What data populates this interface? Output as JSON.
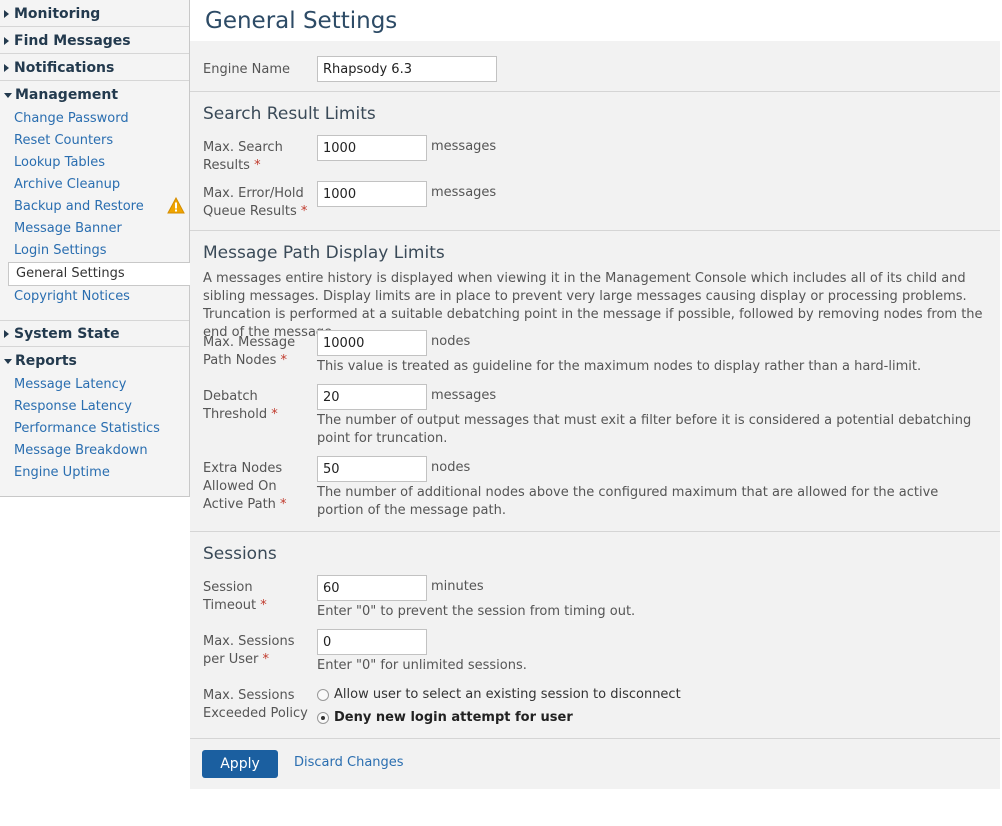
{
  "sidebar": {
    "monitoring": "Monitoring",
    "find_messages": "Find Messages",
    "notifications": "Notifications",
    "management": "Management",
    "management_items": [
      "Change Password",
      "Reset Counters",
      "Lookup Tables",
      "Archive Cleanup",
      "Backup and Restore",
      "Message Banner",
      "Login Settings",
      "General Settings",
      "Copyright Notices"
    ],
    "active_item": "General Settings",
    "warning_item": "Backup and Restore",
    "system_state": "System State",
    "reports": "Reports",
    "reports_items": [
      "Message Latency",
      "Response Latency",
      "Performance Statistics",
      "Message Breakdown",
      "Engine Uptime"
    ]
  },
  "page": {
    "title": "General Settings"
  },
  "engine": {
    "label": "Engine Name",
    "value": "Rhapsody 6.3"
  },
  "search_limits": {
    "title": "Search Result Limits",
    "max_search_label_1": "Max. Search",
    "max_search_label_2": "Results",
    "max_search_value": "1000",
    "max_search_unit": "messages",
    "max_error_label_1": "Max. Error/Hold",
    "max_error_label_2": "Queue Results",
    "max_error_value": "1000",
    "max_error_unit": "messages"
  },
  "path_limits": {
    "title": "Message Path Display Limits",
    "description": "A messages entire history is displayed when viewing it in the Management Console which includes all of its child and sibling messages. Display limits are in place to prevent very large messages causing display or processing problems. Truncation is performed at a suitable debatching point in the message if possible, followed by removing nodes from the end of the message.",
    "max_nodes_label_1": "Max. Message",
    "max_nodes_label_2": "Path Nodes",
    "max_nodes_value": "10000",
    "max_nodes_unit": "nodes",
    "max_nodes_help": "This value is treated as guideline for the maximum nodes to display rather than a hard-limit.",
    "debatch_label_1": "Debatch",
    "debatch_label_2": "Threshold",
    "debatch_value": "20",
    "debatch_unit": "messages",
    "debatch_help": "The number of output messages that must exit a filter before it is considered a potential debatching point for truncation.",
    "extra_label_1": "Extra Nodes",
    "extra_label_2": "Allowed On",
    "extra_label_3": "Active Path",
    "extra_value": "50",
    "extra_unit": "nodes",
    "extra_help": "The number of additional nodes above the configured maximum that are allowed for the active portion of the message path."
  },
  "sessions": {
    "title": "Sessions",
    "timeout_label_1": "Session",
    "timeout_label_2": "Timeout",
    "timeout_value": "60",
    "timeout_unit": "minutes",
    "timeout_help": "Enter \"0\" to prevent the session from timing out.",
    "max_label_1": "Max. Sessions",
    "max_label_2": "per User",
    "max_value": "0",
    "max_help": "Enter \"0\" for unlimited sessions.",
    "policy_label_1": "Max. Sessions",
    "policy_label_2": "Exceeded Policy",
    "policy_option_1": "Allow user to select an existing session to disconnect",
    "policy_option_2": "Deny new login attempt for user",
    "selected_policy": "Deny new login attempt for user"
  },
  "actions": {
    "apply": "Apply",
    "discard": "Discard Changes"
  },
  "required_marker": "*",
  "colors": {
    "accent": "#1b5fa0",
    "link": "#2a6eb0",
    "warning": "#f0a500"
  }
}
